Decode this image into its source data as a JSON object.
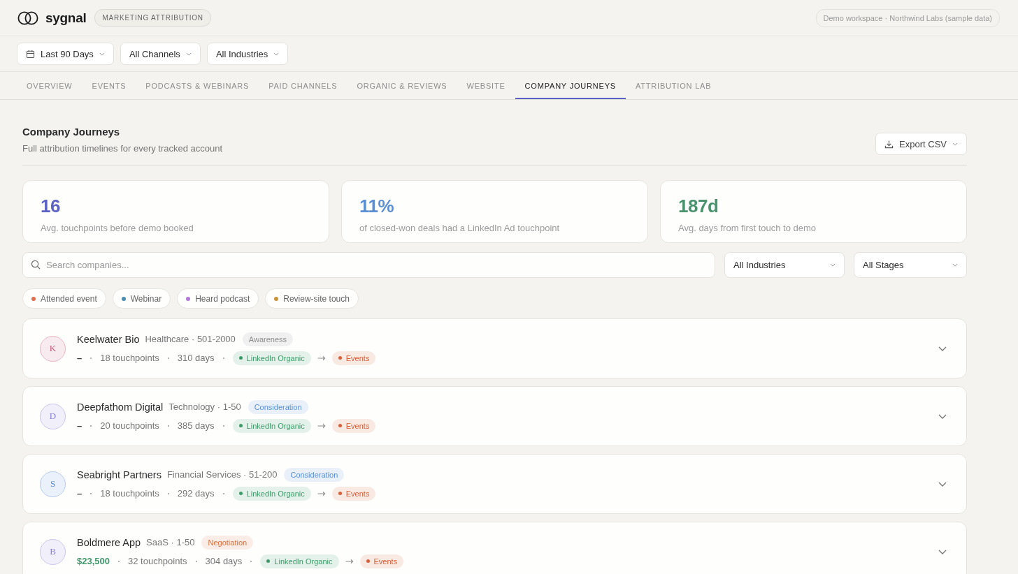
{
  "brand": {
    "name": "sygnal",
    "badge": "MARKETING ATTRIBUTION"
  },
  "workspace": "Demo workspace · Northwind Labs (sample data)",
  "filters": [
    {
      "label": "Last 90 Days",
      "kind": "date"
    },
    {
      "label": "All Channels",
      "kind": "select"
    },
    {
      "label": "All Industries",
      "kind": "select"
    }
  ],
  "tabs": [
    {
      "label": "OVERVIEW",
      "selected": false
    },
    {
      "label": "EVENTS",
      "selected": false
    },
    {
      "label": "PODCASTS & WEBINARS",
      "selected": false
    },
    {
      "label": "PAID CHANNELS",
      "selected": false
    },
    {
      "label": "ORGANIC & REVIEWS",
      "selected": false
    },
    {
      "label": "WEBSITE",
      "selected": false
    },
    {
      "label": "COMPANY JOURNEYS",
      "selected": true
    },
    {
      "label": "ATTRIBUTION LAB",
      "selected": false
    }
  ],
  "page": {
    "title": "Company Journeys",
    "subtitle": "Full attribution timelines for every tracked account",
    "export_button": "Export CSV"
  },
  "stats": [
    {
      "value": "16",
      "label": "Avg. touchpoints before demo booked",
      "color": "#5b62c2"
    },
    {
      "value": "11%",
      "label": "of closed-won deals had a LinkedIn Ad touchpoint",
      "color": "#5b8fd4"
    },
    {
      "value": "187d",
      "label": "Avg. days from first touch to demo",
      "color": "#4a936e"
    }
  ],
  "search": {
    "placeholder": "Search companies..."
  },
  "selects": [
    "All Industries",
    "All Stages"
  ],
  "legend": [
    {
      "label": "Attended event",
      "color": "#df6f4e"
    },
    {
      "label": "Webinar",
      "color": "#4b8db0"
    },
    {
      "label": "Heard podcast",
      "color": "#b17ad8"
    },
    {
      "label": "Review-site touch",
      "color": "#c8963a"
    }
  ],
  "companies": [
    {
      "initial": "K",
      "name": "Keelwater Bio",
      "meta": "Healthcare · 501-2000",
      "color": "#c75a80",
      "stage": {
        "label": "Awareness",
        "color": "#8e8e8e"
      },
      "value": {
        "text": "–",
        "color": "#3a3a3a"
      },
      "touchpoints": "18 touchpoints",
      "days": "310 days",
      "path": [
        {
          "label": "LinkedIn Organic",
          "color": "#3f9a6a"
        },
        {
          "label": "Events",
          "color": "#d5603a"
        }
      ],
      "expanded": false
    },
    {
      "initial": "D",
      "name": "Deepfathom Digital",
      "meta": "Technology · 1-50",
      "color": "#8a7fd2",
      "stage": {
        "label": "Consideration",
        "color": "#5b8fd4"
      },
      "value": {
        "text": "–",
        "color": "#3a3a3a"
      },
      "touchpoints": "20 touchpoints",
      "days": "385 days",
      "path": [
        {
          "label": "LinkedIn Organic",
          "color": "#3f9a6a"
        },
        {
          "label": "Events",
          "color": "#d5603a"
        }
      ],
      "expanded": false
    },
    {
      "initial": "S",
      "name": "Seabright Partners",
      "meta": "Financial Services · 51-200",
      "color": "#5a8bd2",
      "stage": {
        "label": "Consideration",
        "color": "#5b8fd4"
      },
      "value": {
        "text": "–",
        "color": "#3a3a3a"
      },
      "touchpoints": "18 touchpoints",
      "days": "292 days",
      "path": [
        {
          "label": "LinkedIn Organic",
          "color": "#3f9a6a"
        },
        {
          "label": "Events",
          "color": "#d5603a"
        }
      ],
      "expanded": false
    },
    {
      "initial": "B",
      "name": "Boldmere App",
      "meta": "SaaS · 1-50",
      "color": "#8a7fd2",
      "stage": {
        "label": "Negotiation",
        "color": "#d9703f"
      },
      "value": {
        "text": "$23,500",
        "color": "#3f9a6a"
      },
      "touchpoints": "32 touchpoints",
      "days": "304 days",
      "path": [
        {
          "label": "LinkedIn Organic",
          "color": "#3f9a6a"
        },
        {
          "label": "Events",
          "color": "#d5603a"
        }
      ],
      "expanded": false
    }
  ]
}
